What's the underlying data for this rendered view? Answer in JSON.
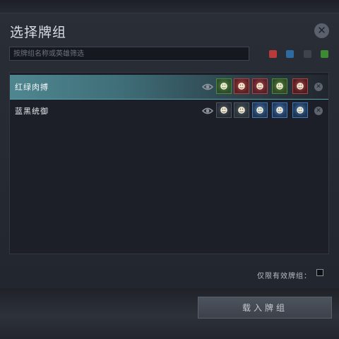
{
  "dialog": {
    "title": "选择牌组",
    "close_icon": "close-icon",
    "search": {
      "placeholder": "按牌组名称或英雄筛选",
      "value": ""
    },
    "color_filters": [
      {
        "name": "red-filter",
        "color": "#b83a3a"
      },
      {
        "name": "blue-filter",
        "color": "#2c6aa0"
      },
      {
        "name": "black-filter",
        "color": "#3f434c"
      },
      {
        "name": "green-filter",
        "color": "#3c8a32"
      }
    ]
  },
  "decks": [
    {
      "name": "红绿肉搏",
      "selected": true,
      "heroes": [
        {
          "icon": "hero-portrait-green-icon",
          "border": "#4a8a3a",
          "bg": "#2f4a2c",
          "glyph": "☻"
        },
        {
          "icon": "hero-portrait-red-icon",
          "border": "#b04040",
          "bg": "#5a2224",
          "glyph": "☻"
        },
        {
          "icon": "hero-portrait-red-icon",
          "border": "#b04040",
          "bg": "#55222a",
          "glyph": "☻"
        },
        {
          "icon": "hero-portrait-green-icon",
          "border": "#4a8a3a",
          "bg": "#334a26",
          "glyph": "☻"
        },
        {
          "icon": "hero-portrait-red-icon",
          "border": "#b04040",
          "bg": "#4e1e22",
          "glyph": "☻"
        }
      ]
    },
    {
      "name": "蓝黑统御",
      "selected": false,
      "heroes": [
        {
          "icon": "hero-portrait-black-icon",
          "border": "#4d5560",
          "bg": "#262c34",
          "glyph": "☻"
        },
        {
          "icon": "hero-portrait-black-icon",
          "border": "#4d5560",
          "bg": "#28343a",
          "glyph": "☻"
        },
        {
          "icon": "hero-portrait-blue-icon",
          "border": "#3f78b8",
          "bg": "#233852",
          "glyph": "☻"
        },
        {
          "icon": "hero-portrait-blue-icon",
          "border": "#3f78b8",
          "bg": "#22385a",
          "glyph": "☻"
        },
        {
          "icon": "hero-portrait-blue-icon",
          "border": "#3f78b8",
          "bg": "#1f3450",
          "glyph": "☻"
        }
      ]
    }
  ],
  "footer": {
    "valid_only_label": "仅限有效牌组：",
    "valid_only_checked": false,
    "load_button": "载入牌组"
  }
}
